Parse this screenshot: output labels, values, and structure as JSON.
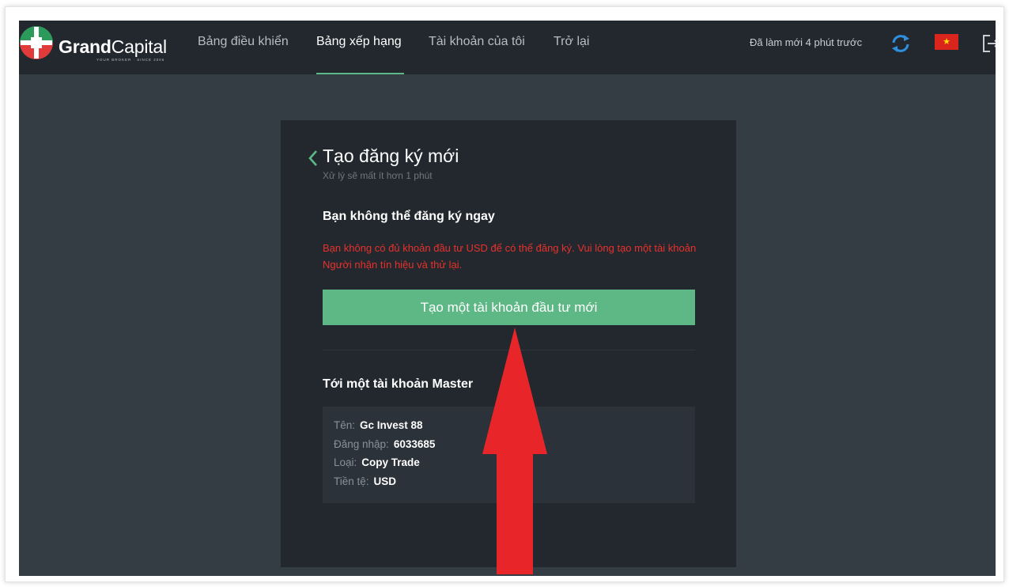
{
  "logo": {
    "bold": "Grand",
    "light": "Capital",
    "tagline": "YOUR BROKER · SINCE 2006"
  },
  "nav": {
    "items": [
      {
        "label": "Bảng điều khiển",
        "active": false
      },
      {
        "label": "Bảng xếp hạng",
        "active": true
      },
      {
        "label": "Tài khoản của tôi",
        "active": false
      },
      {
        "label": "Trở lại",
        "active": false
      }
    ],
    "refresh_status": "Đã làm mới 4 phút trước",
    "icons": [
      "refresh-icon",
      "vietnam-flag-icon",
      "logout-icon"
    ]
  },
  "panel": {
    "title": "Tạo đăng ký mới",
    "subtitle": "Xử lý sẽ mất ít hơn 1 phút",
    "cannot_subscribe_heading": "Bạn không thể đăng ký ngay",
    "error_message": "Bạn không có đủ khoản đầu tư USD để có thể đăng ký. Vui lòng tạo một tài khoản Người nhận tín hiệu và thử lại.",
    "create_button": "Tạo một tài khoản đầu tư mới",
    "master_heading": "Tới một tài khoản Master",
    "master_info": {
      "name_label": "Tên:",
      "name_value": "Gc Invest 88",
      "login_label": "Đăng nhập:",
      "login_value": "6033685",
      "type_label": "Loại:",
      "type_value": "Copy Trade",
      "currency_label": "Tiền tệ:",
      "currency_value": "USD"
    }
  },
  "colors": {
    "accent_green": "#5db886",
    "error_red": "#e8312c",
    "annotation_arrow": "#e8262a",
    "nav_bg": "#22282e",
    "page_bg": "#343c44"
  }
}
